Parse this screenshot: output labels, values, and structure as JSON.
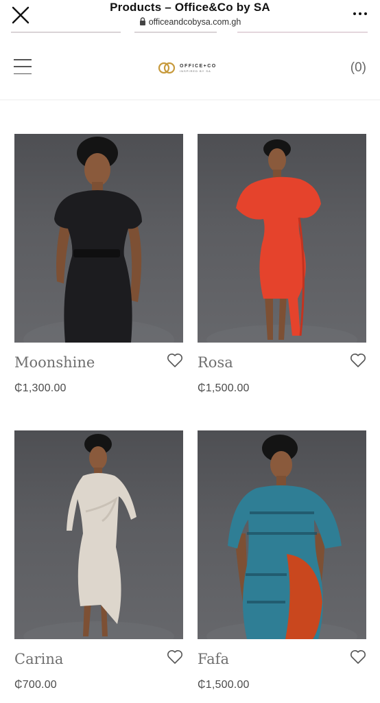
{
  "browser": {
    "title": "Products – Office&Co by SA",
    "url": "officeandcobysa.com.gh"
  },
  "header": {
    "logo_name": "OFFICE+CO",
    "logo_tagline": "INSPIRED BY SA",
    "cart_label": "(0)"
  },
  "products": [
    {
      "name": "Moonshine",
      "price": "₵1,300.00",
      "dress_color": "#1c1c1f"
    },
    {
      "name": "Rosa",
      "price": "₵1,500.00",
      "dress_color": "#e5432c"
    },
    {
      "name": "Carina",
      "price": "₵700.00",
      "dress_color": "#ddd6cc"
    },
    {
      "name": "Fafa",
      "price": "₵1,500.00",
      "dress_color": "#2f7e95"
    }
  ],
  "colors": {
    "name_text": "#6f6f6f",
    "price_text": "#4a4a4a",
    "photo_backdrop": "#5b5c60"
  }
}
